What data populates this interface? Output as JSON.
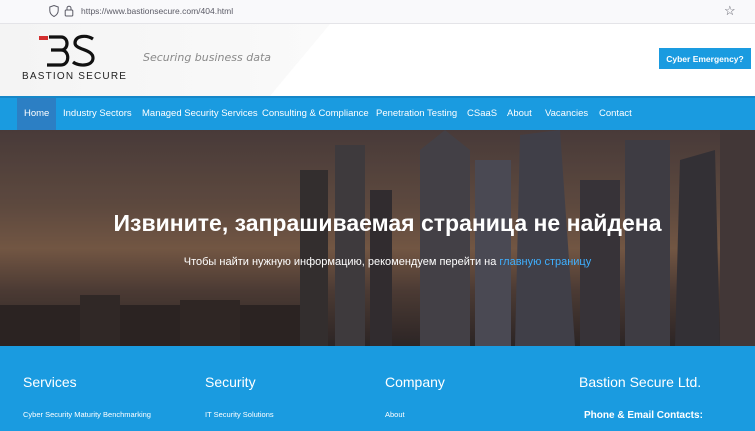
{
  "browser": {
    "url": "https://www.bastionsecure.com/404.html",
    "icons": [
      "shield-icon",
      "lock-icon",
      "bookmark-star-icon"
    ]
  },
  "header": {
    "logo_text": "BASTION SECURE",
    "tagline": "Securing business data",
    "cyber_button": "Cyber Emergency?",
    "brand_color": "#1a9be0",
    "logo_accent": "#d32f2f"
  },
  "nav": {
    "items": [
      "Home",
      "Industry Sectors",
      "Managed Security Services",
      "Consulting & Compliance",
      "Penetration Testing",
      "CSaaS",
      "About",
      "Vacancies",
      "Contact"
    ],
    "active": "Home"
  },
  "hero": {
    "title": "Извините, запрашиваемая страница не найдена",
    "subtitle": "Чтобы найти нужную информацию, рекомендуем перейти на",
    "link_text": "главную страницу"
  },
  "footer": {
    "columns": [
      {
        "title": "Services",
        "links": [
          "Cyber Security Maturity Benchmarking"
        ]
      },
      {
        "title": "Security",
        "links": [
          "IT Security Solutions"
        ]
      },
      {
        "title": "Company",
        "links": [
          "About"
        ]
      },
      {
        "title": "Bastion Secure Ltd.",
        "links": []
      }
    ],
    "contact_heading": "Phone & Email Contacts:"
  }
}
